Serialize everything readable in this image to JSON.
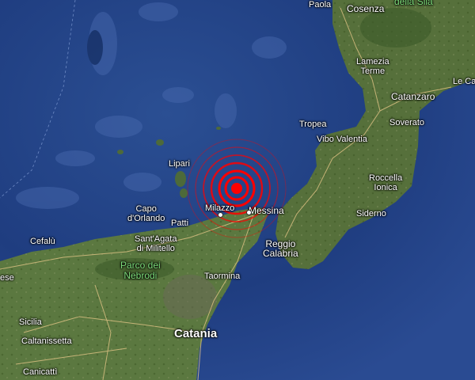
{
  "map": {
    "parks": {
      "sila": "della Sila",
      "nebrodi": "Parco dei\nNebrodi"
    },
    "places": {
      "paola": "Paola",
      "cosenza": "Cosenza",
      "lamezia": "Lamezia\nTerme",
      "catanzaro": "Catanzaro",
      "le_castella": "Le Ca",
      "tropea": "Tropea",
      "soverato": "Soverato",
      "vibo": "Vibo Valentia",
      "lipari": "Lipari",
      "roccella": "Roccella\nIonica",
      "capo_dorlando": "Capo\nd'Orlando",
      "patti": "Patti",
      "milazzo": "Milazzo",
      "messina": "Messina",
      "siderno": "Siderno",
      "cefalu": "Cefalù",
      "santagata": "Sant'Agata\ndi Militello",
      "reggio": "Reggio\nCalabria",
      "taormina": "Taormina",
      "ese": "ese",
      "sicilia": "Sicilia",
      "caltanissetta": "Caltanissetta",
      "catania": "Catania",
      "canicatti": "Canicattì"
    },
    "marker": {
      "name": "epicenter-marker",
      "color": "#ff0000",
      "rings": 6
    }
  }
}
